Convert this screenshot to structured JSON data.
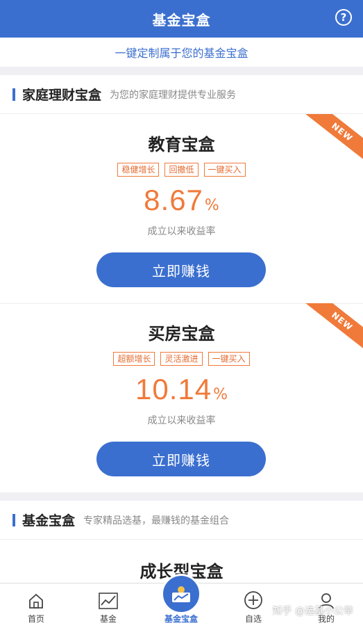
{
  "header": {
    "title": "基金宝盒",
    "help_glyph": "?"
  },
  "tagline": "一键定制属于您的基金宝盒",
  "section_family": {
    "title": "家庭理财宝盒",
    "subtitle": "为您的家庭理财提供专业服务",
    "cards": [
      {
        "ribbon": "NEW",
        "title": "教育宝盒",
        "tags": [
          "稳健增长",
          "回撤低",
          "一键买入"
        ],
        "rate_value": "8.67",
        "rate_unit": "%",
        "rate_label": "成立以来收益率",
        "cta_label": "立即赚钱"
      },
      {
        "ribbon": "NEW",
        "title": "买房宝盒",
        "tags": [
          "超额增长",
          "灵活激进",
          "一键买入"
        ],
        "rate_value": "10.14",
        "rate_unit": "%",
        "rate_label": "成立以来收益率",
        "cta_label": "立即赚钱"
      }
    ]
  },
  "section_fund": {
    "title": "基金宝盒",
    "subtitle": "专家精品选基，最赚钱的基金组合",
    "card_title": "成长型宝盒"
  },
  "tabbar": {
    "tabs": [
      {
        "label": "首页",
        "icon": "home-icon"
      },
      {
        "label": "基金",
        "icon": "chart-icon"
      },
      {
        "label": "基金宝盒",
        "icon": "treasure-box-icon",
        "active": true
      },
      {
        "label": "自选",
        "icon": "plus-circle-icon"
      },
      {
        "label": "我的",
        "icon": "user-icon"
      }
    ]
  },
  "watermark": "知乎 @选基小公举",
  "colors": {
    "primary": "#3b6fcf",
    "accent": "#f07a3a"
  }
}
